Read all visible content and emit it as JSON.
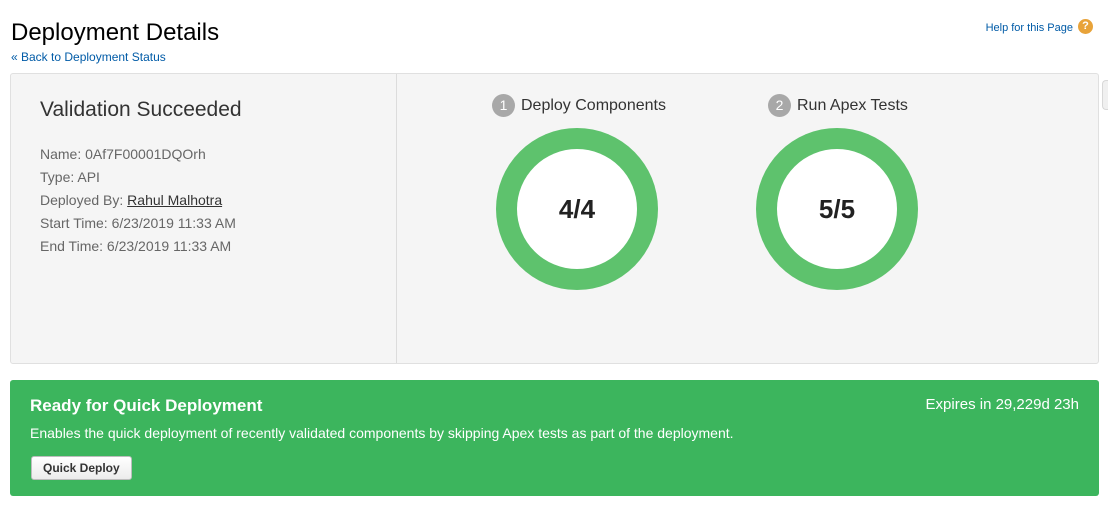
{
  "header": {
    "title": "Deployment Details",
    "back_link": "« Back to Deployment Status",
    "help_link": "Help for this Page",
    "help_icon_glyph": "?"
  },
  "result": {
    "heading": "Validation Succeeded",
    "name_label": "Name:",
    "name_value": "0Af7F00001DQOrh",
    "type_label": "Type:",
    "type_value": "API",
    "deployed_by_label": "Deployed By:",
    "deployed_by_value": "Rahul Malhotra",
    "start_label": "Start Time:",
    "start_value": "6/23/2019 11:33 AM",
    "end_label": "End Time:",
    "end_value": "6/23/2019 11:33 AM"
  },
  "steps": [
    {
      "number": "1",
      "label": "Deploy Components",
      "progress": "4/4",
      "completed": 4,
      "total": 4
    },
    {
      "number": "2",
      "label": "Run Apex Tests",
      "progress": "5/5",
      "completed": 5,
      "total": 5
    }
  ],
  "quick_deploy": {
    "title": "Ready for Quick Deployment",
    "expires": "Expires in 29,229d 23h",
    "description": "Enables the quick deployment of recently validated components by skipping Apex tests as part of the deployment.",
    "button_label": "Quick Deploy"
  },
  "colors": {
    "success_green": "#3cb55d",
    "ring_green": "#5ec26d",
    "link_blue": "#015ba7",
    "help_orange": "#e8a33a"
  }
}
